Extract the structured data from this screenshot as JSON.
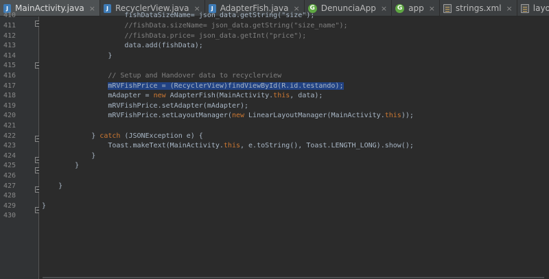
{
  "tabs": [
    {
      "label": "MainActivity.java",
      "icon": "java-file-icon",
      "active": true
    },
    {
      "label": "RecyclerView.java",
      "icon": "java-file-icon",
      "active": false
    },
    {
      "label": "AdapterFish.java",
      "icon": "java-file-icon",
      "active": false
    },
    {
      "label": "DenunciaApp",
      "icon": "gradle-icon",
      "active": false
    },
    {
      "label": "app",
      "icon": "gradle-icon",
      "active": false
    },
    {
      "label": "strings.xml",
      "icon": "xml-file-icon",
      "active": false
    },
    {
      "label": "layout\\activity_main.xml",
      "icon": "xml-file-icon",
      "active": false
    }
  ],
  "close_glyph": "×",
  "colors": {
    "keyword": "#cc7832",
    "comment": "#808080",
    "identifier": "#a9b7c6",
    "selection": "#214283",
    "background": "#2b2b2b"
  },
  "code": {
    "lines": [
      {
        "num": "410",
        "text": "fishDataSizeName= json_data.getString(\"size\");",
        "indent": "                    "
      },
      {
        "num": "411",
        "text": "//fishData.sizeName= json_data.getString(\"size_name\");",
        "indent": "                    "
      },
      {
        "num": "412",
        "text": "//fishData.price= json_data.getInt(\"price\");",
        "indent": "                    "
      },
      {
        "num": "413",
        "text": "data.add(fishData);",
        "indent": "                    "
      },
      {
        "num": "414",
        "text": "}",
        "indent": "                "
      },
      {
        "num": "415",
        "text": "",
        "indent": ""
      },
      {
        "num": "416",
        "text": "// Setup and Handover data to recyclerview",
        "indent": "                "
      },
      {
        "num": "417",
        "text": "mRVFishPrice = (RecyclerView)findViewById(R.id.testando);",
        "indent": "                "
      },
      {
        "num": "418",
        "pre": "mAdapter = ",
        "kw1": "new",
        "mid": " AdapterFish(MainActivity.",
        "kw2": "this",
        "post": ", data);",
        "indent": "                "
      },
      {
        "num": "419",
        "text": "mRVFishPrice.setAdapter(mAdapter);",
        "indent": "                "
      },
      {
        "num": "420",
        "pre": "mRVFishPrice.setLayoutManager(",
        "kw1": "new",
        "mid": " LinearLayoutManager(MainActivity.",
        "kw2": "this",
        "post": "));",
        "indent": "                "
      },
      {
        "num": "421",
        "text": "",
        "indent": ""
      },
      {
        "num": "422",
        "pre": "} ",
        "kw1": "catch",
        "post": " (JSONException e) {",
        "indent": "            "
      },
      {
        "num": "423",
        "pre": "Toast.makeText(MainActivity.",
        "kw1": "this",
        "post": ", e.toString(), Toast.LENGTH_LONG).show();",
        "indent": "                "
      },
      {
        "num": "424",
        "text": "}",
        "indent": "            "
      },
      {
        "num": "425",
        "text": "}",
        "indent": "        "
      },
      {
        "num": "426",
        "text": "",
        "indent": ""
      },
      {
        "num": "427",
        "text": "}",
        "indent": "    "
      },
      {
        "num": "428",
        "text": "",
        "indent": ""
      },
      {
        "num": "429",
        "text": "}",
        "indent": ""
      },
      {
        "num": "430",
        "text": "",
        "indent": ""
      }
    ]
  }
}
